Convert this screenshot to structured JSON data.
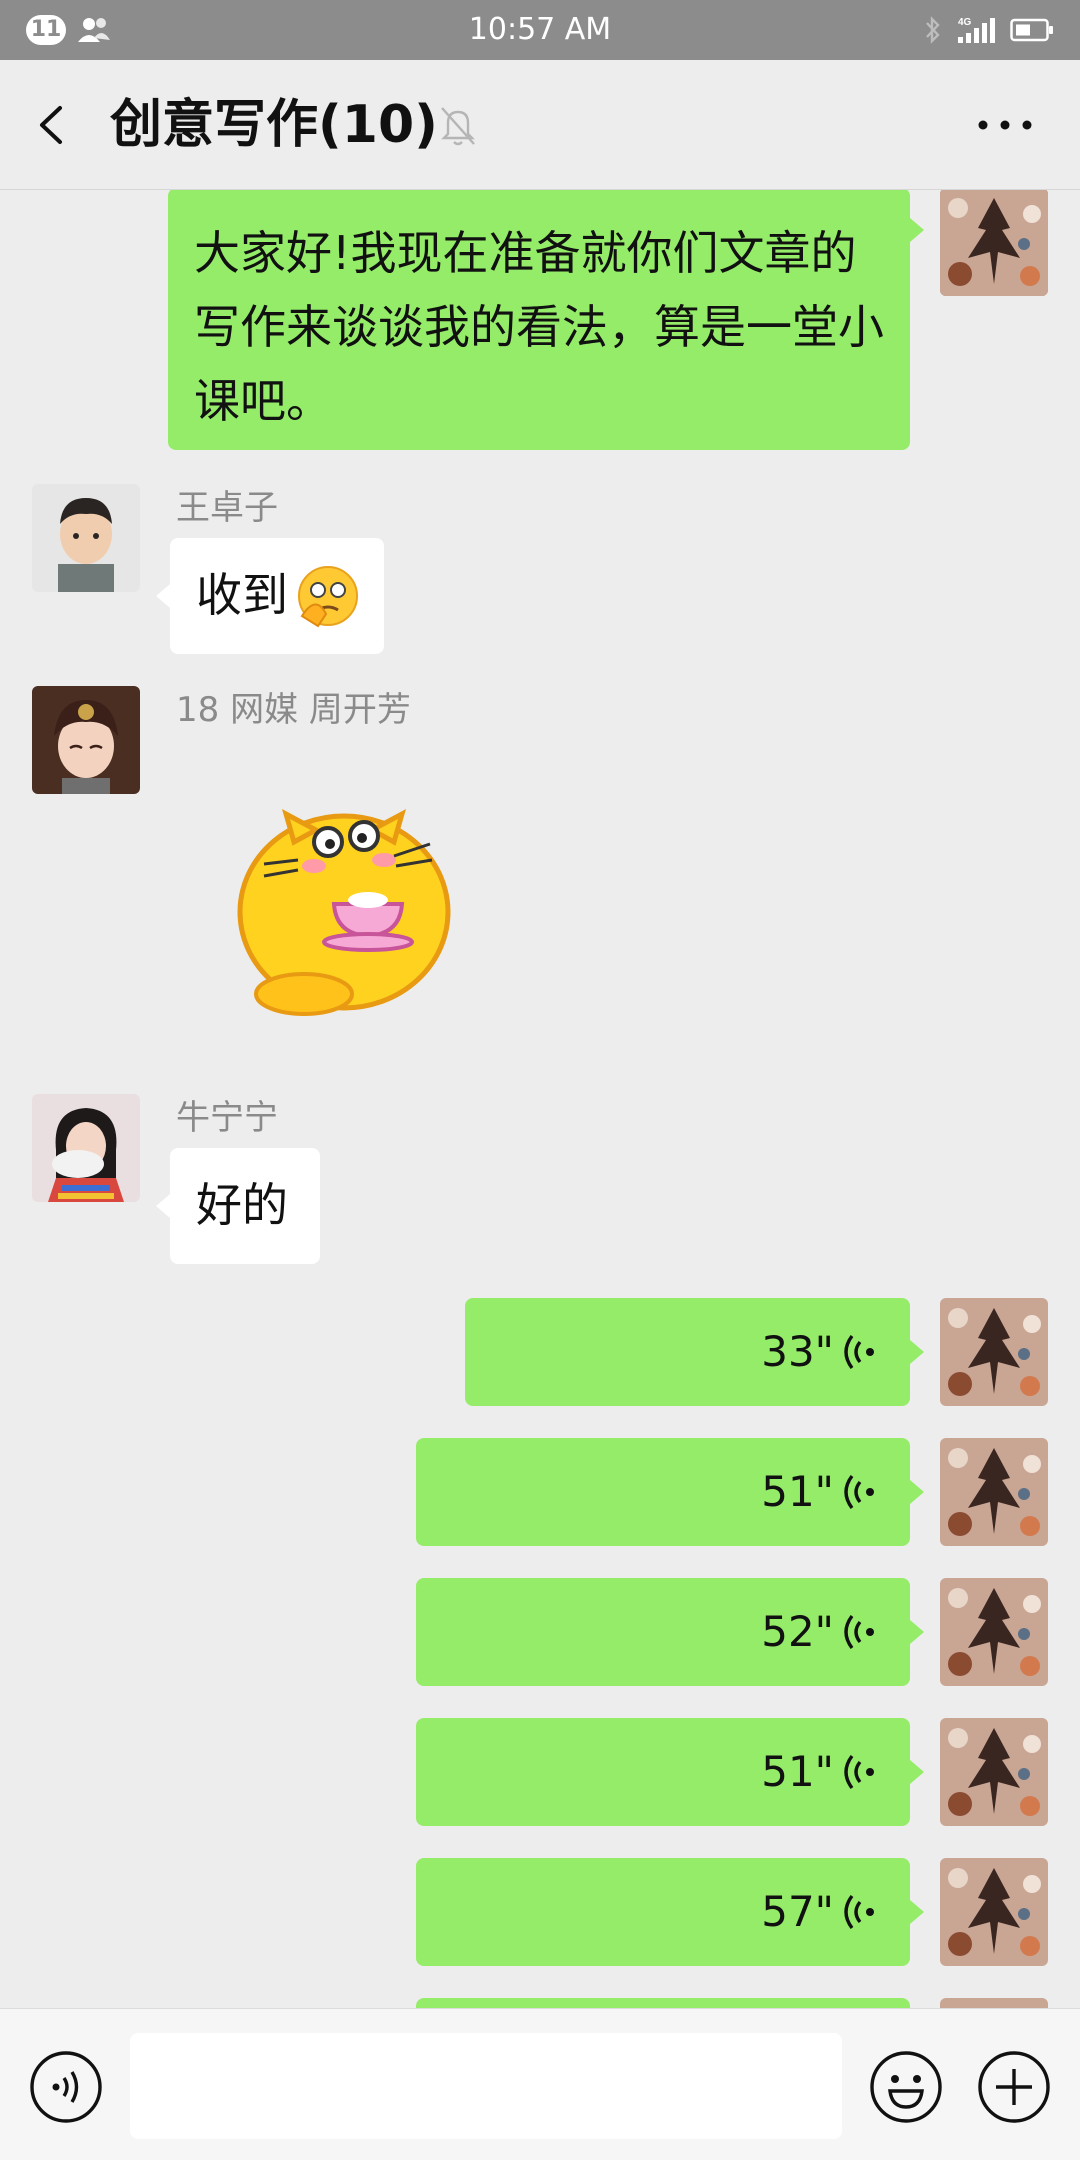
{
  "status_bar": {
    "notification_count": "11",
    "time": "10:57 AM",
    "network": "4G"
  },
  "header": {
    "title": "创意写作(10)",
    "icons": [
      "back-chevron-icon",
      "mute-bell-icon",
      "more-dots-icon"
    ]
  },
  "messages": [
    {
      "type": "text",
      "side": "right",
      "text": "大家好!我现在准备就你们文章的写作来谈谈我的看法，算是一堂小课吧。"
    },
    {
      "type": "text",
      "side": "left",
      "sender": "王卓子",
      "text": "收到"
    },
    {
      "type": "sticker",
      "side": "left",
      "sender": "18 网媒 周开芳",
      "sticker": "cat-drinking-tea-sticker"
    },
    {
      "type": "text",
      "side": "left",
      "sender": "牛宁宁",
      "text": "好的"
    },
    {
      "type": "voice",
      "side": "right",
      "duration": "33\""
    },
    {
      "type": "voice",
      "side": "right",
      "duration": "51\""
    },
    {
      "type": "voice",
      "side": "right",
      "duration": "52\""
    },
    {
      "type": "voice",
      "side": "right",
      "duration": "51\""
    },
    {
      "type": "voice",
      "side": "right",
      "duration": "57\""
    }
  ],
  "input_bar": {
    "icons": [
      "voice-input-icon",
      "emoji-icon",
      "add-icon"
    ],
    "value": ""
  },
  "colors": {
    "bubble_green": "#95ec69",
    "chat_background": "#ededed",
    "status_bar": "#8c8c8c"
  }
}
